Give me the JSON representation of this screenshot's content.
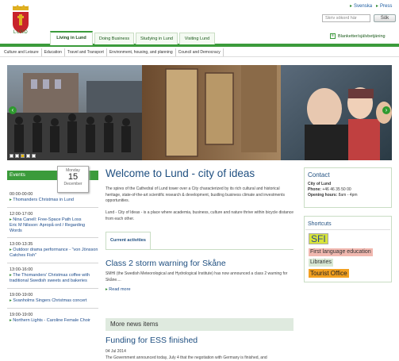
{
  "header": {
    "logo_text": "LUND",
    "lang_label": "Svenska",
    "press_label": "Press",
    "search_placeholder": "Skriv sökord här",
    "search_button": "Sök"
  },
  "nav": {
    "tabs": [
      {
        "label": "Living in Lund"
      },
      {
        "label": "Doing Business"
      },
      {
        "label": "Studying in Lund"
      },
      {
        "label": "Visiting Lund"
      }
    ],
    "forms_label": "Blanketter/självbetjäning"
  },
  "subnav": [
    "Culture and Leisure",
    "Education",
    "Travel and Transport",
    "Environment, housing, and planning",
    "Council and Democracy"
  ],
  "events": {
    "heading": "Events",
    "calendar": {
      "weekday": "Monday",
      "day": "15",
      "month": "December"
    },
    "items": [
      {
        "time": "00:00-00:00",
        "title": "Thomanders Christmas in Lund"
      },
      {
        "time": "12:00-17:00",
        "title": "Nina Canell: Free-Space Path Loss\nEric M Nilsson: Apropå ord / Regarding Words"
      },
      {
        "time": "13:00-13:35",
        "title": "Outdoor drama performance - \"von Jönsson Catches Fish\""
      },
      {
        "time": "13:00-16:00",
        "title": "The Thomanders' Christmas coffee with traditional Swedish sweets and bakeries"
      },
      {
        "time": "19:00-19:00",
        "title": "Svanholms Singers Christmas concert"
      },
      {
        "time": "19:00-19:00",
        "title": "Northern Lights - Caroline Female Choir"
      }
    ]
  },
  "main": {
    "title": "Welcome to Lund - city of ideas",
    "intro1": "The spires of the Cathedral of Lund tower over a City characterized by its rich cultural and historical heritage, state-of-the-art scientific research & development, bustling business climate and investments opportunities.",
    "intro2": "Lund - City of Ideas - is a place where academia, business, culture and nature thrive within bicycle distance from each other.",
    "tab_label": "Current activities",
    "news_title": "Class 2 storm warning for Skåne",
    "news_text": "SMHI (the Swedish Meteorological and Hydrological Institute) has now announced a class 2 warning for Skåne....",
    "read_more": "Read more",
    "more_news": "More news items",
    "news2_title": "Funding for ESS finished",
    "news2_date": "04 Jul 2014",
    "news2_text": "The Government announced today, July 4 that the negotiation with Germany is finished, and"
  },
  "contact": {
    "heading": "Contact",
    "name": "City of Lund",
    "phone_label": "Phone:",
    "phone": "+46 46 35 50 00",
    "hours_label": "Opening hours:",
    "hours": "8am - 4pm"
  },
  "shortcuts": {
    "heading": "Shortcuts",
    "items": [
      "SFI",
      "First language education",
      "Libraries",
      "Tourist Office"
    ]
  },
  "colors": {
    "green": "#3b9b3b",
    "blue": "#1f4f80",
    "sfi": "#d8e43a",
    "tourist": "#f2a020",
    "firstlang": "#f1b8b0"
  }
}
